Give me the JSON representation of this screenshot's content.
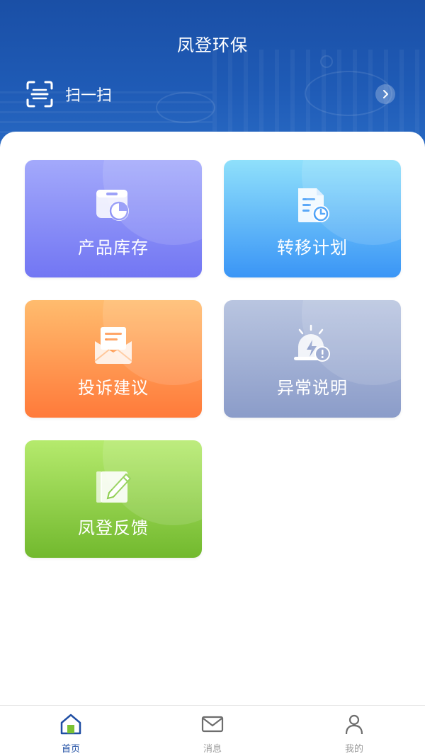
{
  "header": {
    "title": "凤登环保",
    "scan": {
      "label": "扫一扫",
      "icon": "scan-icon",
      "arrow_icon": "chevron-right-icon"
    }
  },
  "cards": [
    {
      "label": "产品库存",
      "icon": "inventory-box-icon",
      "color": "#7b80f5"
    },
    {
      "label": "转移计划",
      "icon": "document-clock-icon",
      "color": "#3f9bf7"
    },
    {
      "label": "投诉建议",
      "icon": "mail-envelope-icon",
      "color": "#ff8a45"
    },
    {
      "label": "异常说明",
      "icon": "alert-lightning-icon",
      "color": "#93a3cd"
    },
    {
      "label": "凤登反馈",
      "icon": "edit-note-icon",
      "color": "#7bc233"
    }
  ],
  "tabbar": {
    "items": [
      {
        "label": "首页",
        "icon": "home-icon",
        "active": true
      },
      {
        "label": "消息",
        "icon": "mail-icon",
        "active": false
      },
      {
        "label": "我的",
        "icon": "user-icon",
        "active": false
      }
    ]
  },
  "colors": {
    "header_blue": "#1f5bb6",
    "active_tab": "#1f4ea3",
    "inactive_tab": "#9a9a9a"
  }
}
